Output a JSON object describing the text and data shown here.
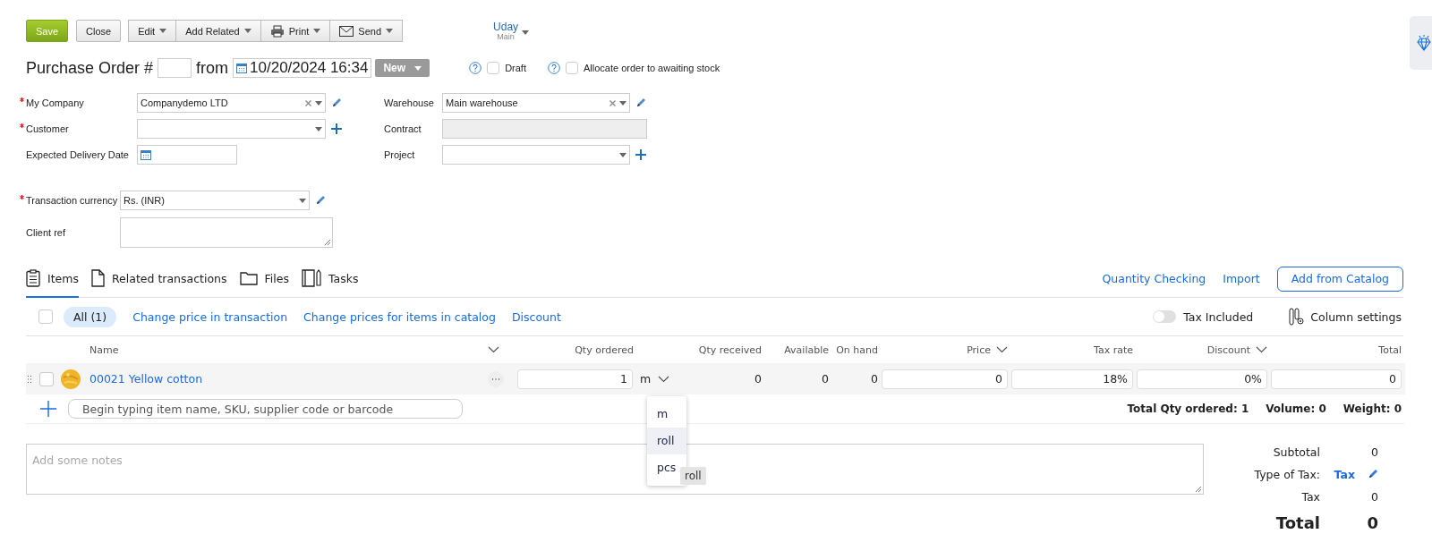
{
  "toolbar": [
    {
      "label": "Save",
      "kind": "primary"
    },
    {
      "label": "Close",
      "kind": "plain"
    },
    {
      "label": "Edit",
      "kind": "menu"
    },
    {
      "label": "Add Related",
      "kind": "menu"
    },
    {
      "label": "Print",
      "kind": "print-menu"
    },
    {
      "label": "Send",
      "kind": "send-menu"
    }
  ],
  "user": {
    "name": "Uday",
    "location": "Main"
  },
  "header": {
    "title": "Purchase Order #",
    "from": "from",
    "date": "10/20/2024 16:34",
    "status": "New"
  },
  "options": [
    {
      "label": "Draft",
      "checked": false
    },
    {
      "label": "Allocate order to awaiting stock",
      "checked": false
    }
  ],
  "form_left": [
    {
      "label": "My Company",
      "required": true,
      "kind": "select",
      "value": "Companydemo LTD",
      "clearable": true,
      "editable": true
    },
    {
      "label": "Customer",
      "required": true,
      "kind": "select",
      "clearable": false,
      "addable": true
    },
    {
      "label": "Expected Delivery Date",
      "required": false,
      "kind": "date"
    }
  ],
  "form_right": [
    {
      "label": "Warehouse",
      "required": false,
      "kind": "select",
      "value": "Main warehouse",
      "clearable": true,
      "editable": true
    },
    {
      "label": "Contract",
      "required": false,
      "kind": "disabled"
    },
    {
      "label": "Project",
      "required": false,
      "kind": "select",
      "clearable": false,
      "addable": true
    }
  ],
  "form_bottom": [
    {
      "label": "Transaction currency",
      "required": true,
      "kind": "select",
      "value": "Rs. (INR)",
      "clearable": false,
      "editable": true
    },
    {
      "label": "Client ref",
      "required": false,
      "kind": "textarea"
    }
  ],
  "tabs": [
    {
      "label": "Items",
      "selected": true
    },
    {
      "label": "Related transactions",
      "selected": false
    },
    {
      "label": "Files",
      "selected": false
    },
    {
      "label": "Tasks",
      "selected": false
    }
  ],
  "tab_actions": [
    {
      "label": "Quantity Checking",
      "kind": "link"
    },
    {
      "label": "Import",
      "kind": "link"
    },
    {
      "label": "Add from Catalog",
      "kind": "outline"
    }
  ],
  "filter": {
    "select_all": false,
    "chip": {
      "label": "All (1)",
      "selected": true
    },
    "links": [
      "Change price in transaction",
      "Change prices for items in catalog",
      "Discount"
    ],
    "tax_included": {
      "label": "Tax Included",
      "on": false
    },
    "column_settings": "Column settings"
  },
  "columns": [
    {
      "label": "Name",
      "menu": true
    },
    {
      "label": "Qty ordered",
      "menu": false
    },
    {
      "label": "Qty received",
      "menu": false
    },
    {
      "label": "Available",
      "menu": false
    },
    {
      "label": "On hand",
      "menu": false
    },
    {
      "label": "Price",
      "menu": true
    },
    {
      "label": "Tax rate",
      "menu": false
    },
    {
      "label": "Discount",
      "menu": true
    },
    {
      "label": "Total",
      "menu": false
    }
  ],
  "rows": [
    {
      "checked": false,
      "name": "00021 Yellow cotton",
      "qty": "1",
      "unit": "m",
      "received": "0",
      "available": "0",
      "on_hand": "0",
      "price": "0",
      "tax_rate": "18%",
      "discount": "0%",
      "total": "0"
    }
  ],
  "unit_menu": {
    "options": [
      {
        "label": "m",
        "selected": false
      },
      {
        "label": "roll",
        "selected": true
      },
      {
        "label": "pcs",
        "selected": false
      }
    ],
    "tooltip": "roll"
  },
  "add_item": {
    "placeholder": "Begin typing item name, SKU, supplier code or barcode"
  },
  "summary": [
    "Total Qty ordered: 1",
    "Volume: 0",
    "Weight: 0"
  ],
  "notes": {
    "placeholder": "Add some notes"
  },
  "totals": [
    {
      "label": "Subtotal",
      "value": "0",
      "kind": "plain"
    },
    {
      "label": "Type of Tax:",
      "value": "Tax",
      "kind": "link"
    },
    {
      "label": "Tax",
      "value": "0",
      "kind": "plain"
    },
    {
      "label": "Total",
      "value": "0",
      "kind": "grand"
    }
  ]
}
